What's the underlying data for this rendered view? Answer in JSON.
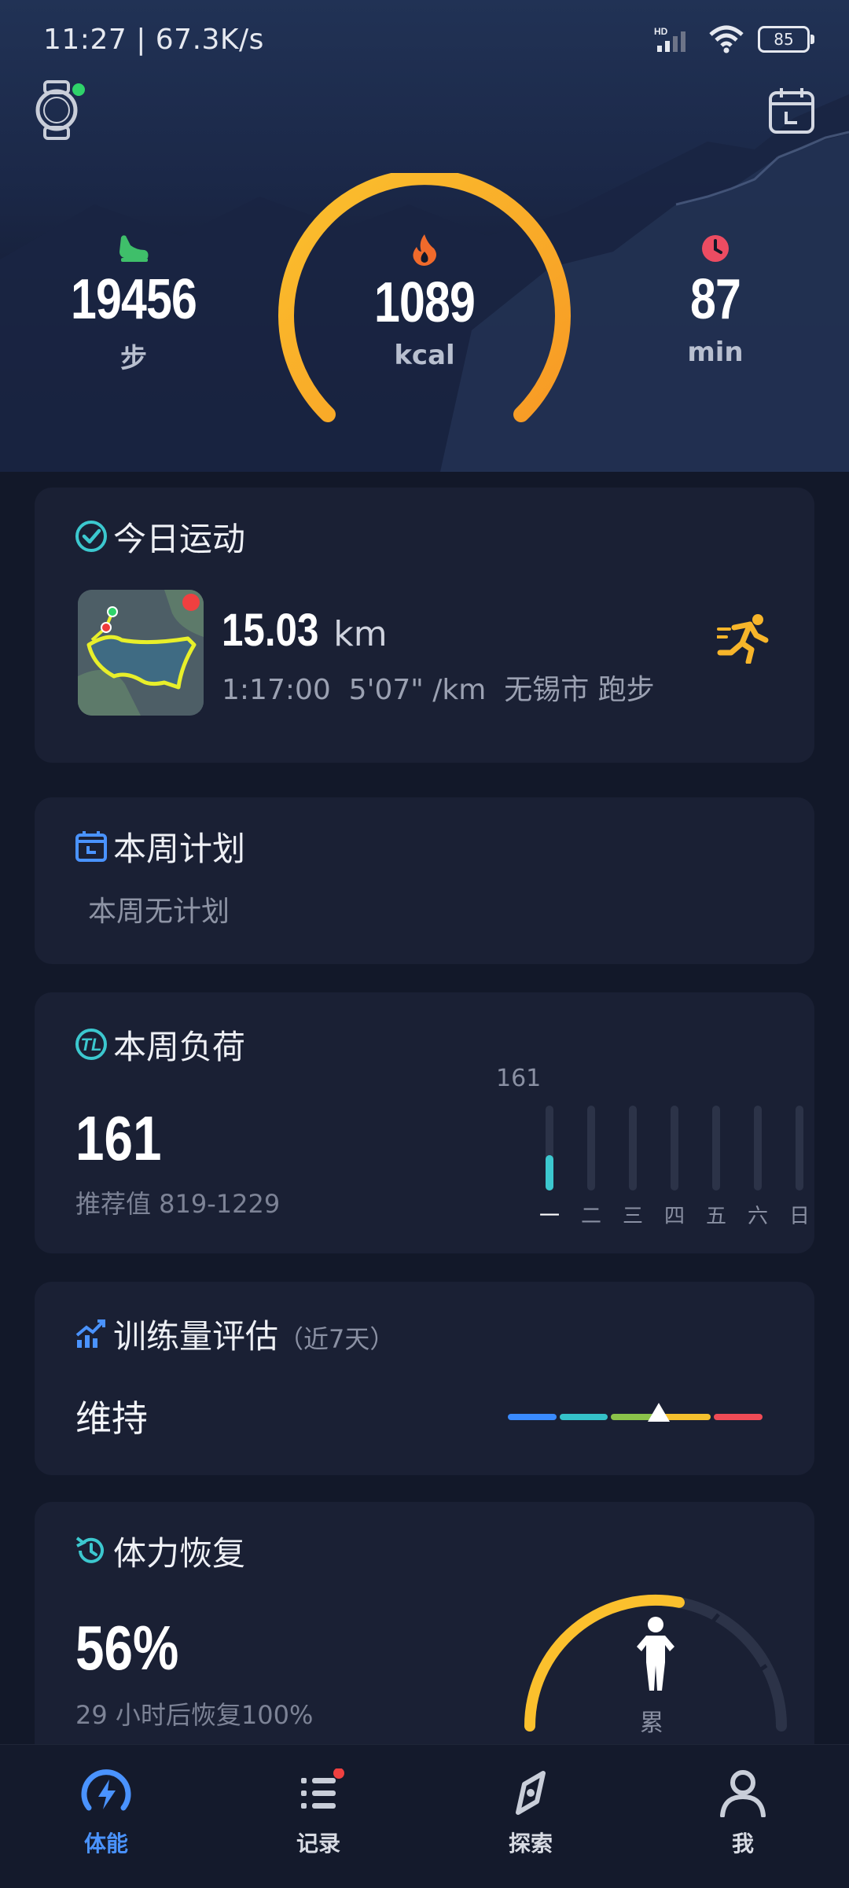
{
  "status_bar": {
    "time": "11:27 | 67.3K/s",
    "network": "HD",
    "battery": "85"
  },
  "summary": {
    "steps": {
      "value": "19456",
      "unit": "步",
      "icon": "shoe-icon"
    },
    "calories": {
      "value": "1089",
      "unit": "kcal",
      "icon": "flame-icon"
    },
    "duration": {
      "value": "87",
      "unit": "min",
      "icon": "clock-icon"
    }
  },
  "today": {
    "title": "今日运动",
    "distance": "15.03",
    "distance_unit": "km",
    "details": "1:17:00  5'07\" /km  无锡市 跑步"
  },
  "plan": {
    "title": "本周计划",
    "empty_text": "本周无计划"
  },
  "load": {
    "title": "本周负荷",
    "value": "161",
    "recommend": "推荐值 819-1229",
    "peak_label": "161",
    "days": [
      "一",
      "二",
      "三",
      "四",
      "五",
      "六",
      "日"
    ],
    "daily_levels": [
      0.42,
      0,
      0,
      0,
      0,
      0,
      0
    ]
  },
  "training": {
    "title": "训练量评估",
    "subtitle": "（近7天）",
    "status": "维持",
    "scale_colors": [
      "#3a8bff",
      "#35c2c9",
      "#8bc34a",
      "#f5c02e",
      "#ef4b56"
    ],
    "marker_position": 0.59
  },
  "recovery": {
    "title": "体力恢复",
    "percent": "56%",
    "detail": "29 小时后恢复100%",
    "state": "累",
    "level": 0.56
  },
  "nav": [
    {
      "label": "体能",
      "icon": "lightning-icon",
      "active": true
    },
    {
      "label": "记录",
      "icon": "list-icon",
      "active": false
    },
    {
      "label": "探索",
      "icon": "compass-icon",
      "active": false
    },
    {
      "label": "我",
      "icon": "person-icon",
      "active": false
    }
  ],
  "colors": {
    "accent": "#4a93ff",
    "teal": "#3cc8cf",
    "orange": "#f7a72a",
    "ring_start": "#fbc02d",
    "ring_end": "#f79a25"
  }
}
